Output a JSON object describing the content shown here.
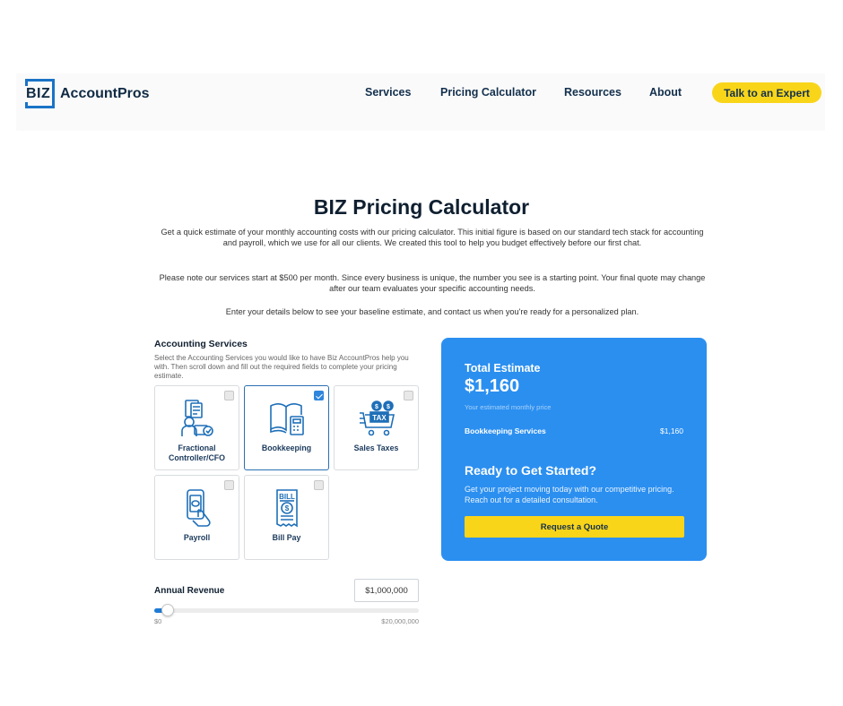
{
  "brand": {
    "logo_mark": "BIZ",
    "logo_name": "AccountPros"
  },
  "nav": {
    "items": [
      "Services",
      "Pricing Calculator",
      "Resources",
      "About"
    ],
    "cta": "Talk to an Expert"
  },
  "intro": {
    "title": "BIZ Pricing Calculator",
    "paragraph_1": "Get a quick estimate of your monthly accounting costs with our pricing calculator. This initial figure is based on our standard tech stack for accounting and payroll, which we use for all our clients. We created this tool to help you budget effectively before our first chat.",
    "paragraph_2": "Please note our services start at $500 per month. Since every business is unique, the number you see is a starting point. Your final quote may change after our team evaluates your specific accounting needs.",
    "paragraph_3": "Enter your details below to see your baseline estimate, and contact us when you're ready for a personalized plan."
  },
  "services": {
    "title": "Accounting Services",
    "description": "Select the Accounting Services you would like to have Biz AccountPros help you with. Then scroll down and fill out the required fields to complete your pricing estimate.",
    "cards": [
      {
        "label": "Fractional Controller/CFO",
        "icon": "controller-cfo-icon",
        "selected": false
      },
      {
        "label": "Bookkeeping",
        "icon": "bookkeeping-icon",
        "selected": true
      },
      {
        "label": "Sales Taxes",
        "icon": "sales-tax-icon",
        "selected": false
      },
      {
        "label": "Payroll",
        "icon": "payroll-icon",
        "selected": false
      },
      {
        "label": "Bill Pay",
        "icon": "bill-pay-icon",
        "selected": false
      }
    ],
    "icon_text": {
      "tax": "TAX",
      "bill": "BILL",
      "dollar": "$"
    }
  },
  "revenue": {
    "label": "Annual Revenue",
    "value": "$1,000,000",
    "min_label": "$0",
    "max_label": "$20,000,000",
    "fraction": 0.05
  },
  "estimate": {
    "title": "Total Estimate",
    "total": "$1,160",
    "subtitle": "Your estimated monthly price",
    "line_label": "Bookkeeping Services",
    "line_value": "$1,160",
    "ready_title": "Ready to Get Started?",
    "ready_text": "Get your project moving today with our competitive pricing. Reach out for a detailed consultation.",
    "button": "Request a Quote"
  },
  "colors": {
    "accent_blue": "#2b8ff0",
    "cta_yellow": "#f9d51a",
    "navy": "#13304d",
    "icon_blue": "#1e6fb8"
  }
}
